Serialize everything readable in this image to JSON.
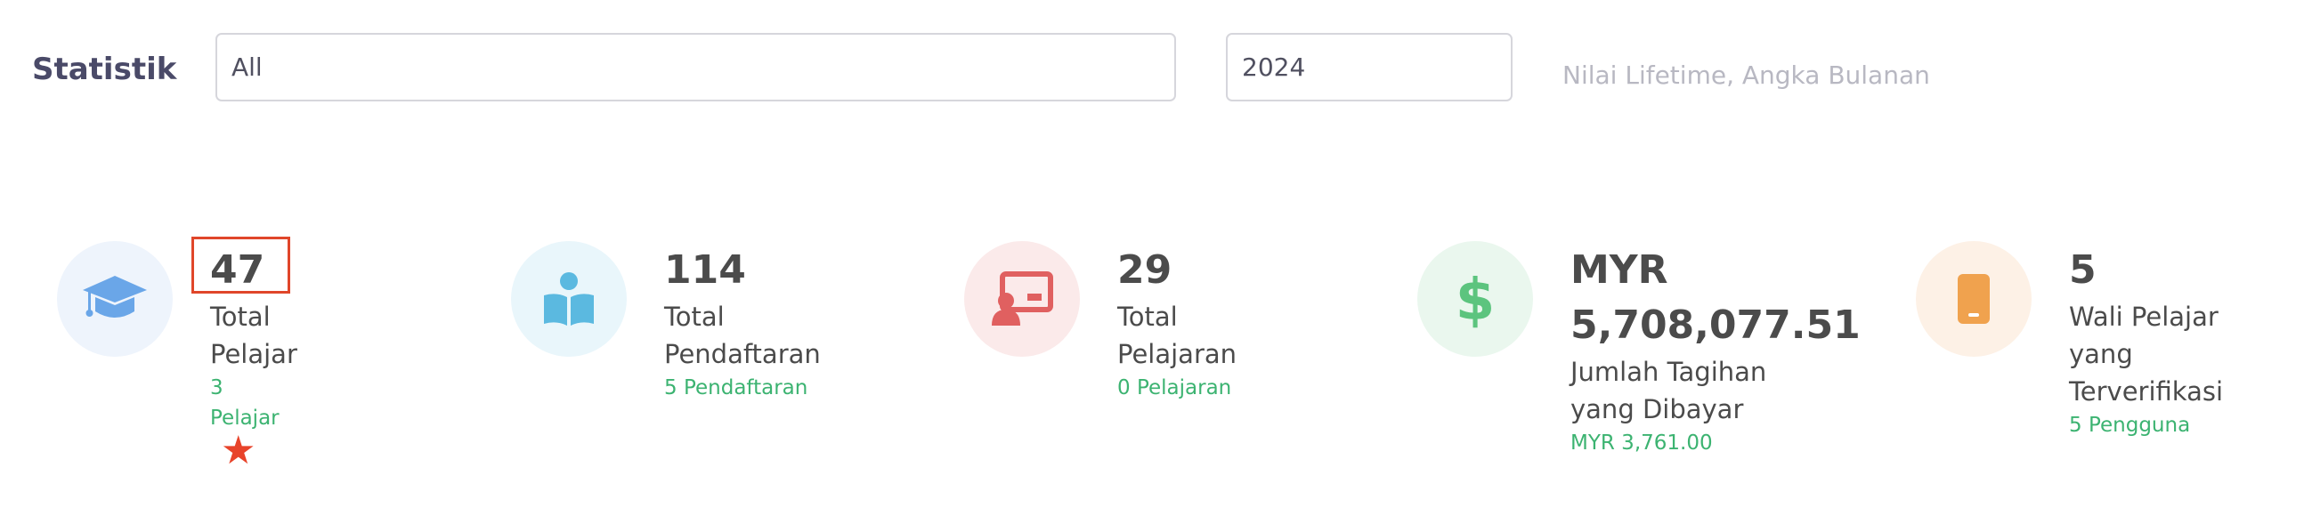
{
  "header": {
    "title": "Statistik",
    "filter_value": "All",
    "year_value": "2024",
    "hint": "Nilai Lifetime, Angka Bulanan"
  },
  "stats": [
    {
      "value": "47",
      "label": "Total Pelajar",
      "sub": "3 Pelajar",
      "icon": "graduation-cap-icon",
      "color": "#6aa6e8"
    },
    {
      "value": "114",
      "label": "Total Pendaftaran",
      "sub": "5 Pendaftaran",
      "icon": "book-reader-icon",
      "color": "#5bb9e0"
    },
    {
      "value": "29",
      "label": "Total Pelajaran",
      "sub": "0 Pelajaran",
      "icon": "teacher-board-icon",
      "color": "#e06060"
    },
    {
      "value": "MYR 5,708,077.51",
      "label": "Jumlah Tagihan yang Dibayar",
      "sub": "MYR 3,761.00",
      "icon": "dollar-icon",
      "color": "#5cc47e"
    },
    {
      "value": "5",
      "label": "Wali Pelajar yang Terverifikasi",
      "sub": "5 Pengguna",
      "icon": "mobile-phone-icon",
      "color": "#f0a24e"
    }
  ]
}
